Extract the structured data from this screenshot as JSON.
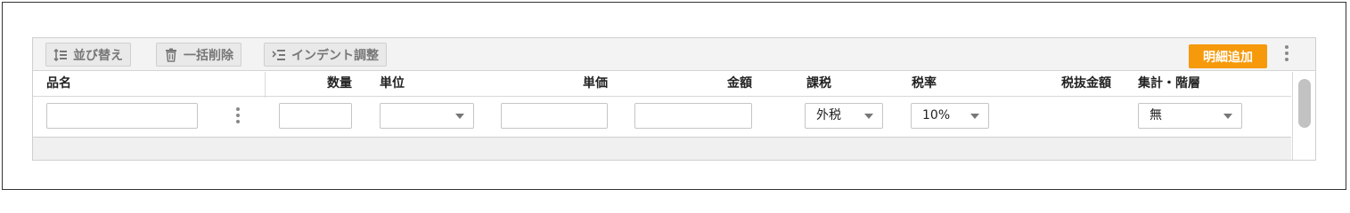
{
  "toolbar": {
    "sort_label": "並び替え",
    "bulk_delete_label": "一括削除",
    "indent_label": "インデント調整",
    "add_detail_label": "明細追加"
  },
  "columns": {
    "item_name": "品名",
    "quantity": "数量",
    "unit": "単位",
    "unit_price": "単価",
    "amount": "金額",
    "taxation": "課税",
    "tax_rate": "税率",
    "tax_excluded_amount": "税抜金額",
    "aggregation_level": "集計・階層"
  },
  "row": {
    "item_name": "",
    "quantity": "",
    "unit": "",
    "unit_price": "",
    "amount": "",
    "taxation": "外税",
    "tax_rate": "10%",
    "aggregation_level": "無"
  },
  "colors": {
    "accent": "#f6990a",
    "toolbar_bg": "#f3f3f3",
    "footer_bg": "#f0f0f0"
  }
}
